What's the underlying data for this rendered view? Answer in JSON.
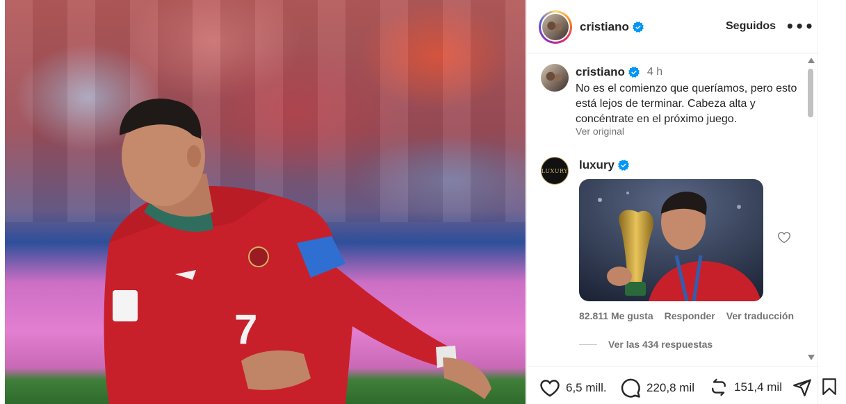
{
  "post": {
    "image_alt": "Jugador con camiseta roja número 7",
    "jersey_number": "7"
  },
  "header": {
    "username": "cristiano",
    "follow_label": "Seguidos",
    "more_label": "•••"
  },
  "caption": {
    "username": "cristiano",
    "time": "4 h",
    "text": "No es el comienzo que queríamos, pero esto está lejos de terminar. Cabeza alta y concéntrate en el próximo juego.",
    "see_original": "Ver original"
  },
  "comment": {
    "username": "luxury",
    "avatar_text": "LUXURY",
    "likes": "82.811 Me gusta",
    "reply_label": "Responder",
    "translate_label": "Ver traducción",
    "view_replies": "Ver las 434 respuestas"
  },
  "actions": {
    "likes": "6,5 mill.",
    "comments": "220,8 mil",
    "reposts": "151,4 mil"
  },
  "colors": {
    "verified": "#0095f6",
    "text": "#262626",
    "muted": "#737373"
  },
  "icons": [
    "verified-badge-icon",
    "more-options-icon",
    "heart-icon",
    "comment-icon",
    "repost-icon",
    "share-icon",
    "bookmark-icon"
  ]
}
